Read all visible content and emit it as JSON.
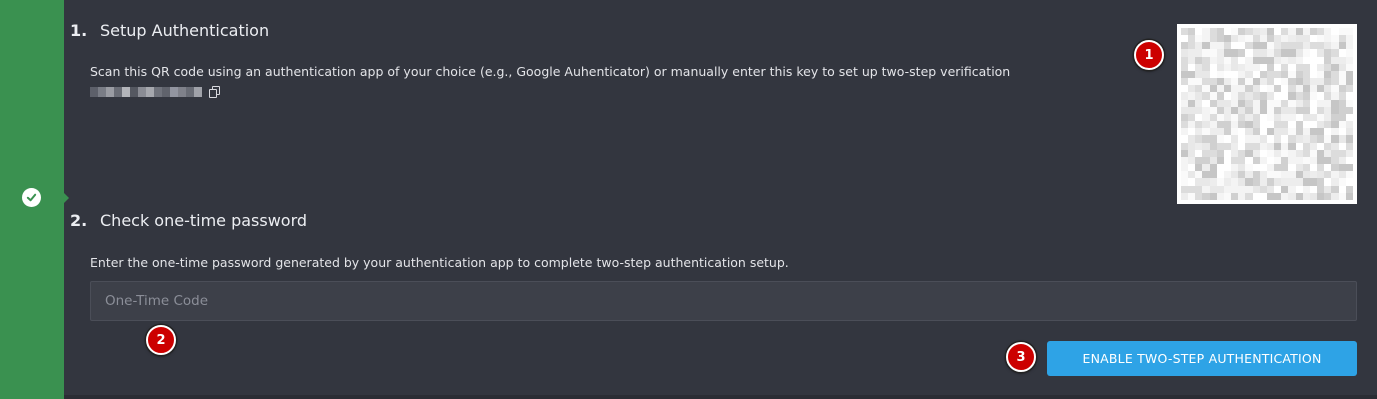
{
  "steps": [
    {
      "number": "1.",
      "title": "Setup Authentication",
      "description": "Scan this QR code using an authentication app of your choice (e.g., Google Auhenticator) or manually enter this key to set up two-step verification"
    },
    {
      "number": "2.",
      "title": "Check one-time password",
      "description": "Enter the one-time password generated by your authentication app to complete two-step authentication setup."
    }
  ],
  "otp_input": {
    "placeholder": "One-Time Code",
    "value": ""
  },
  "enable_button": {
    "label": "ENABLE TWO-STEP AUTHENTICATION"
  },
  "markers": [
    "1",
    "2",
    "3"
  ],
  "colors": {
    "sidebar": "#3a9150",
    "background": "#33363f",
    "button": "#2ea3e6",
    "marker": "#cc0000"
  },
  "icons": {
    "status": "check-circle-icon",
    "copy": "copy-icon"
  }
}
